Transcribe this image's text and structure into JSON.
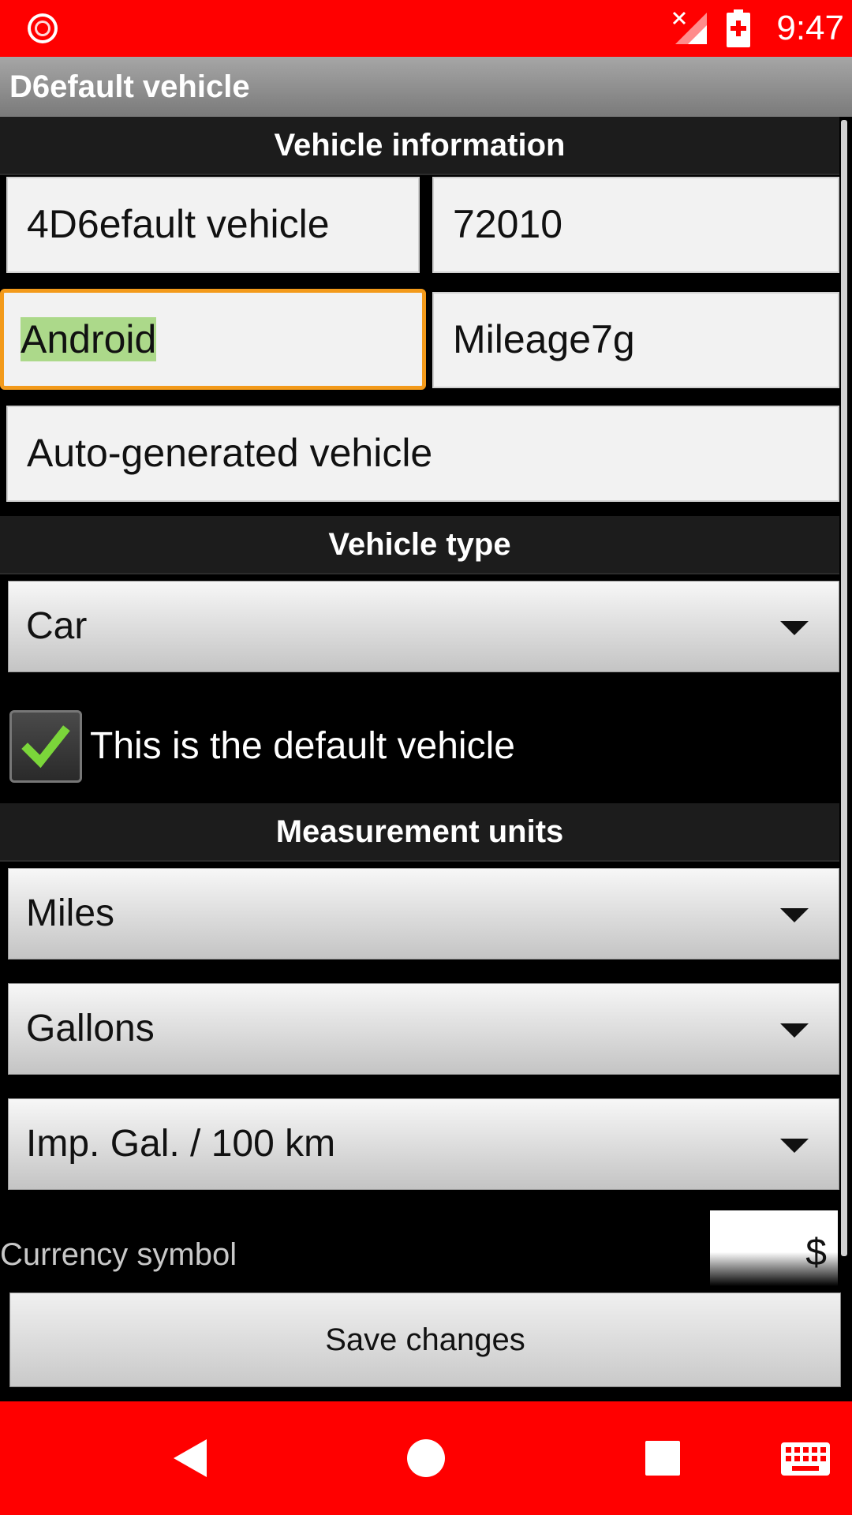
{
  "status_bar": {
    "time": "9:47"
  },
  "app": {
    "title": "D6efault vehicle"
  },
  "vehicle_information": {
    "header": "Vehicle information",
    "name_value": "4D6efault vehicle",
    "year_value": "72010",
    "make_value": "Android",
    "model_value": "Mileage7g",
    "description_value": "Auto-generated vehicle"
  },
  "vehicle_type": {
    "header": "Vehicle type",
    "selected": "Car"
  },
  "default_vehicle": {
    "label": "This is the default vehicle",
    "checked": true
  },
  "measurement_units": {
    "header": "Measurement units",
    "distance_selected": "Miles",
    "volume_selected": "Gallons",
    "economy_selected": "Imp. Gal. / 100 km"
  },
  "currency": {
    "label": "Currency symbol",
    "value": "$"
  },
  "actions": {
    "save_label": "Save changes"
  },
  "colors": {
    "system_bar": "#ff0000",
    "focus_border": "#f39a1a",
    "text_selection": "#acd98a",
    "checkmark": "#7bd63a"
  },
  "icons": {
    "status": [
      "screen-record-icon",
      "no-signal-icon",
      "battery-charging-icon"
    ],
    "navigation": [
      "back-icon",
      "home-icon",
      "recents-icon",
      "keyboard-icon"
    ]
  }
}
